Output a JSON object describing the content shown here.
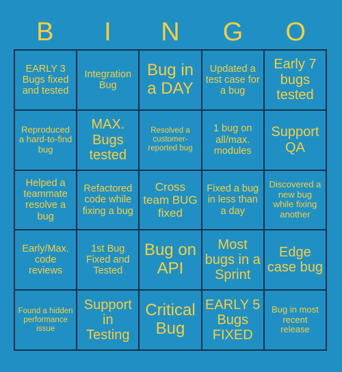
{
  "card": {
    "header_letters": [
      "B",
      "I",
      "N",
      "G",
      "O"
    ],
    "colors": {
      "background": "#2090c4",
      "text": "#f5ce42",
      "border": "#16304a"
    },
    "grid": {
      "columns": 5,
      "rows": 5,
      "cells": [
        {
          "row": 1,
          "col": 1,
          "text": "EARLY 3 Bugs fixed and tested",
          "size": "fs-md"
        },
        {
          "row": 1,
          "col": 2,
          "text": "Integration Bug",
          "size": "fs-md"
        },
        {
          "row": 1,
          "col": 3,
          "text": "Bug in a DAY",
          "size": "fs-xxl"
        },
        {
          "row": 1,
          "col": 4,
          "text": "Updated a test case for a bug",
          "size": "fs-md"
        },
        {
          "row": 1,
          "col": 5,
          "text": "Early 7 bugs tested",
          "size": "fs-xl"
        },
        {
          "row": 2,
          "col": 1,
          "text": "Reproduced a hard-to-find bug",
          "size": "fs-sm"
        },
        {
          "row": 2,
          "col": 2,
          "text": "MAX. Bugs tested",
          "size": "fs-xl"
        },
        {
          "row": 2,
          "col": 3,
          "text": "Resolved a customer-reported bug",
          "size": "fs-xs"
        },
        {
          "row": 2,
          "col": 4,
          "text": "1 bug on all/max. modules",
          "size": "fs-md"
        },
        {
          "row": 2,
          "col": 5,
          "text": "Support QA",
          "size": "fs-xl"
        },
        {
          "row": 3,
          "col": 1,
          "text": "Helped a teammate resolve a bug",
          "size": "fs-md"
        },
        {
          "row": 3,
          "col": 2,
          "text": "Refactored code while fixing a bug",
          "size": "fs-md"
        },
        {
          "row": 3,
          "col": 3,
          "text": "Cross team BUG fixed",
          "size": "fs-lg"
        },
        {
          "row": 3,
          "col": 4,
          "text": "Fixed a bug in less than a day",
          "size": "fs-md"
        },
        {
          "row": 3,
          "col": 5,
          "text": "Discovered a new bug while fixing another",
          "size": "fs-sm"
        },
        {
          "row": 4,
          "col": 1,
          "text": "Early/Max. code reviews",
          "size": "fs-md"
        },
        {
          "row": 4,
          "col": 2,
          "text": "1st Bug Fixed and Tested",
          "size": "fs-md"
        },
        {
          "row": 4,
          "col": 3,
          "text": "Bug on API",
          "size": "fs-xxl"
        },
        {
          "row": 4,
          "col": 4,
          "text": "Most bugs in a Sprint",
          "size": "fs-xl"
        },
        {
          "row": 4,
          "col": 5,
          "text": "Edge case bug",
          "size": "fs-xl"
        },
        {
          "row": 5,
          "col": 1,
          "text": "Found a hidden performance issue",
          "size": "fs-xs"
        },
        {
          "row": 5,
          "col": 2,
          "text": "Support in Testing",
          "size": "fs-xl"
        },
        {
          "row": 5,
          "col": 3,
          "text": "Critical Bug",
          "size": "fs-xxl"
        },
        {
          "row": 5,
          "col": 4,
          "text": "EARLY 5 Bugs FIXED",
          "size": "fs-xl"
        },
        {
          "row": 5,
          "col": 5,
          "text": "Bug in most recent release",
          "size": "fs-sm"
        }
      ]
    }
  }
}
